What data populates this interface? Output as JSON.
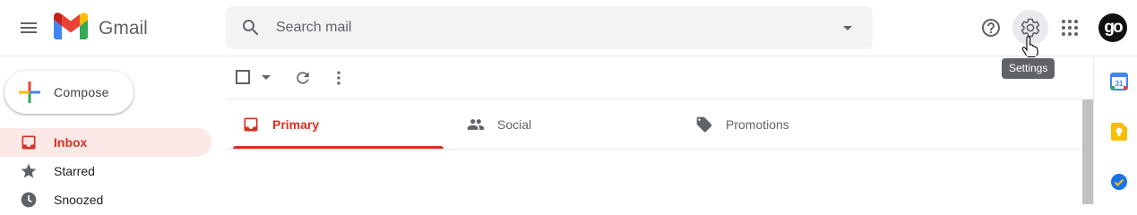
{
  "header": {
    "brand": "Gmail",
    "search_placeholder": "Search mail",
    "avatar_text": "go"
  },
  "tooltip": {
    "text": "Settings"
  },
  "compose": {
    "label": "Compose"
  },
  "sidebar": {
    "items": [
      {
        "label": "Inbox",
        "icon": "inbox-icon",
        "active": true
      },
      {
        "label": "Starred",
        "icon": "star-icon"
      },
      {
        "label": "Snoozed",
        "icon": "clock-icon"
      }
    ]
  },
  "tabs": [
    {
      "label": "Primary",
      "icon": "inbox-icon",
      "active": true
    },
    {
      "label": "Social",
      "icon": "people-icon"
    },
    {
      "label": "Promotions",
      "icon": "tag-icon"
    }
  ],
  "side_panel": {
    "apps": [
      {
        "name": "calendar-icon",
        "text": "31"
      },
      {
        "name": "keep-icon"
      },
      {
        "name": "tasks-icon"
      }
    ]
  },
  "colors": {
    "accent_red": "#d93025",
    "active_bg": "#fce8e6",
    "search_bg": "#f1f3f4"
  }
}
